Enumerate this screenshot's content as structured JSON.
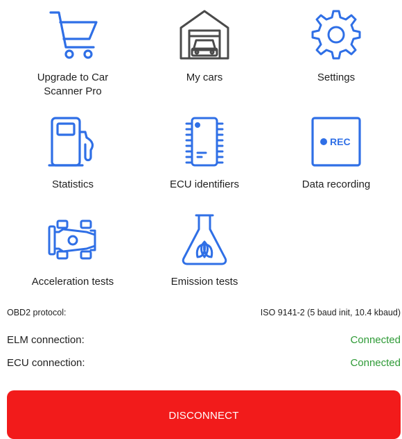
{
  "colors": {
    "icon_blue": "#2f6fe6",
    "status_ok": "#2e9a36",
    "disconnect_red": "#f21b1b"
  },
  "tiles": [
    {
      "label": "Upgrade to Car\nScanner Pro",
      "icon": "shopping-cart-icon"
    },
    {
      "label": "My cars",
      "icon": "garage-icon"
    },
    {
      "label": "Settings",
      "icon": "gear-icon"
    },
    {
      "label": "Statistics",
      "icon": "fuel-pump-icon"
    },
    {
      "label": "ECU identifiers",
      "icon": "chip-icon"
    },
    {
      "label": "Data recording",
      "icon": "rec-icon"
    },
    {
      "label": "Acceleration tests",
      "icon": "race-car-icon"
    },
    {
      "label": "Emission tests",
      "icon": "flask-leaf-icon"
    }
  ],
  "rec_badge": "REC",
  "info": {
    "obd2_protocol_label": "OBD2 protocol:",
    "obd2_protocol_value": "ISO 9141-2 (5 baud init, 10.4 kbaud)",
    "elm_connection_label": "ELM connection:",
    "elm_connection_value": "Connected",
    "ecu_connection_label": "ECU connection:",
    "ecu_connection_value": "Connected"
  },
  "disconnect_label": "DISCONNECT"
}
